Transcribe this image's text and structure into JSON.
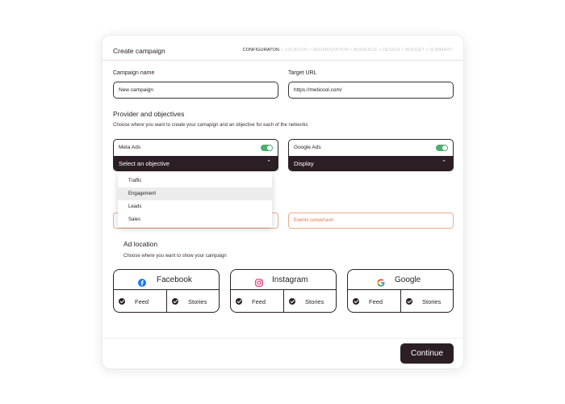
{
  "header": {
    "title": "Create campaign",
    "steps_active": "CONFIGURATON",
    "steps_rest": " > LOCATION > SEGMENTATION > AUDIENCE > DESIGN > BUDGET > SUMMARY"
  },
  "form": {
    "campaign_name_label": "Campaign name",
    "campaign_name_value": "New campaign",
    "target_url_label": "Target URL",
    "target_url_value": "https://meticool.com/"
  },
  "providers": {
    "title": "Provider and objectives",
    "subtitle": "Choose where you want to create your camapign and an objective for each of the networks",
    "meta": {
      "name": "Meta Ads",
      "enabled": true,
      "objective": "Select an objective"
    },
    "google": {
      "name": "Google Ads",
      "enabled": true,
      "objective": "Display",
      "outcome": "Events conversion"
    },
    "dropdown_options": [
      "Traffic",
      "Engagement",
      "Leads",
      "Sales"
    ],
    "dropdown_highlighted": "Engagement",
    "toggle_color": "#4caf6d"
  },
  "ad_location": {
    "title": "Ad location",
    "subtitle": "Choose where you want to show your campaign",
    "networks": [
      {
        "name": "Facebook",
        "icon": "facebook-icon",
        "left_option": "Feed",
        "right_option": "Stories"
      },
      {
        "name": "Instagram",
        "icon": "instagram-icon",
        "left_option": "Feed",
        "right_option": "Stories"
      },
      {
        "name": "Google",
        "icon": "google-icon",
        "left_option": "Feed",
        "right_option": "Stories"
      }
    ]
  },
  "footer": {
    "continue_label": "Continue"
  },
  "colors": {
    "primary_dark": "#2b1e26",
    "outcome_border": "#f2a98a",
    "outcome_text": "#e0704a",
    "facebook": "#1877f2",
    "instagram": "#e1306c"
  }
}
